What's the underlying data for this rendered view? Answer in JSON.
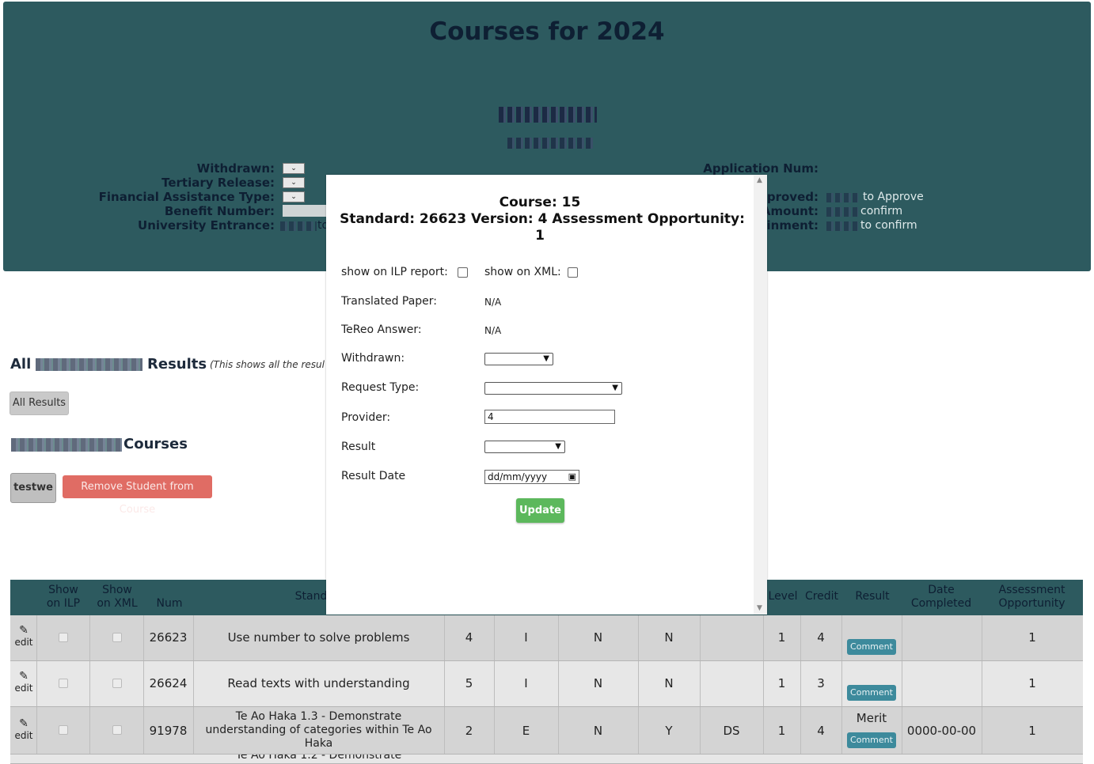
{
  "header": {
    "title": "Courses for 2024",
    "fields_left": [
      {
        "label": "Withdrawn:"
      },
      {
        "label": "Tertiary Release:"
      },
      {
        "label": "Financial Assistance Type:"
      },
      {
        "label": "Benefit Number:"
      },
      {
        "label": "University Entrance:",
        "value_fragment": "to"
      }
    ],
    "fields_right": [
      {
        "label": "Application Num:",
        "value": ""
      },
      {
        "label": "pproved:",
        "value": "to Approve"
      },
      {
        "label": "Amount:",
        "value": "confirm"
      },
      {
        "label": "inment:",
        "value": "to confirm"
      }
    ]
  },
  "results": {
    "title_prefix": "All",
    "title_suffix": "Results",
    "note": "(This shows all the resul",
    "all_results_button": "All Results",
    "courses_title": "Courses",
    "course_tab": "testwe",
    "remove_button": "Remove Student from Course"
  },
  "table": {
    "headers": {
      "show_ilp": "Show on ILP",
      "show_xml": "Show on XML",
      "num": "Num",
      "standard": "Stand",
      "level": "Level",
      "credit": "Credit",
      "result": "Result",
      "date_completed": "Date Completed",
      "assessment_opportunity": "Assessment Opportunity"
    },
    "edit_label": "edit",
    "comment_label": "Comment",
    "rows": [
      {
        "num": "26623",
        "title": "Use number to solve problems",
        "version": "4",
        "type": "I",
        "col_a": "N",
        "col_b": "N",
        "col_c": "",
        "level": "1",
        "credit": "4",
        "result": "",
        "date": "",
        "opportunity": "1"
      },
      {
        "num": "26624",
        "title": "Read texts with understanding",
        "version": "5",
        "type": "I",
        "col_a": "N",
        "col_b": "N",
        "col_c": "",
        "level": "1",
        "credit": "3",
        "result": "",
        "date": "",
        "opportunity": "1"
      },
      {
        "num": "91978",
        "title": "Te Ao Haka 1.3 - Demonstrate understanding of categories within Te Ao Haka",
        "version": "2",
        "type": "E",
        "col_a": "N",
        "col_b": "Y",
        "col_c": "DS",
        "level": "1",
        "credit": "4",
        "result": "Merit",
        "date": "0000-00-00",
        "opportunity": "1"
      },
      {
        "title_partial": "Te Ao Haka 1.2 - Demonstrate"
      }
    ]
  },
  "modal": {
    "course_line": "Course: 15",
    "standard_line": "Standard: 26623 Version: 4 Assessment Opportunity:",
    "standard_line2": "1",
    "show_ilp_label": "show on ILP report:",
    "show_xml_label": "show on XML:",
    "translated_paper_label": "Translated Paper:",
    "translated_paper_value": "N/A",
    "tereo_answer_label": "TeReo Answer:",
    "tereo_answer_value": "N/A",
    "withdrawn_label": "Withdrawn:",
    "request_type_label": "Request Type:",
    "provider_label": "Provider:",
    "provider_value": "4",
    "result_label": "Result",
    "result_date_label": "Result Date",
    "result_date_placeholder": "dd/mm/yyyy",
    "update_button": "Update"
  },
  "colors": {
    "header_bg": "#2d5a5f",
    "update_button": "#5cb85c",
    "remove_button": "#e06c64",
    "comment_button": "#3d8a9c"
  }
}
